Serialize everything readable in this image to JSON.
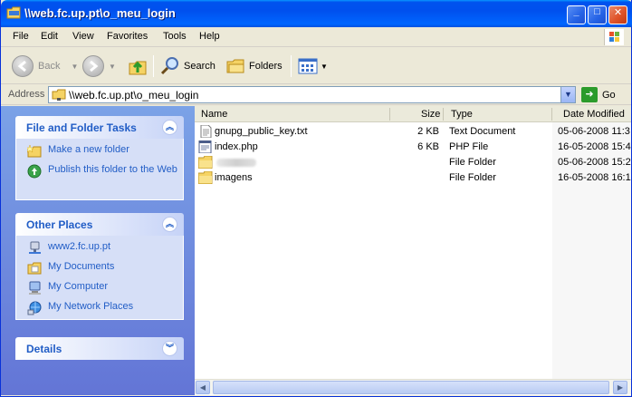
{
  "window": {
    "title": "\\\\web.fc.up.pt\\o_meu_login",
    "controls": [
      "_",
      "□",
      "✕"
    ]
  },
  "menu": [
    "File",
    "Edit",
    "View",
    "Favorites",
    "Tools",
    "Help"
  ],
  "toolbar": {
    "back_label": "Back",
    "search_label": "Search",
    "folders_label": "Folders"
  },
  "address": {
    "label": "Address",
    "value": "\\\\web.fc.up.pt\\o_meu_login",
    "go_label": "Go"
  },
  "sidebar": {
    "file_tasks": {
      "title": "File and Folder Tasks",
      "items": [
        "Make a new folder",
        "Publish this folder to the Web"
      ]
    },
    "other_places": {
      "title": "Other Places",
      "items": [
        "www2.fc.up.pt",
        "My Documents",
        "My Computer",
        "My Network Places"
      ]
    },
    "details": {
      "title": "Details"
    }
  },
  "columns": {
    "name": "Name",
    "size": "Size",
    "type": "Type",
    "date": "Date Modified"
  },
  "files": [
    {
      "name": "gnupg_public_key.txt",
      "size": "2 KB",
      "type": "Text Document",
      "date": "05-06-2008 11:3",
      "icon": "text-file-icon"
    },
    {
      "name": "index.php",
      "size": "6 KB",
      "type": "PHP File",
      "date": "16-05-2008 15:4",
      "icon": "php-file-icon"
    },
    {
      "name": "",
      "size": "",
      "type": "File Folder",
      "date": "05-06-2008 15:2",
      "icon": "folder-icon"
    },
    {
      "name": "imagens",
      "size": "",
      "type": "File Folder",
      "date": "16-05-2008 16:1",
      "icon": "folder-icon"
    }
  ],
  "colors": {
    "title_blue": "#0053ee",
    "link_blue": "#215dc6",
    "sidebar_top": "#7ba2e7",
    "sidebar_bottom": "#6375d6"
  }
}
